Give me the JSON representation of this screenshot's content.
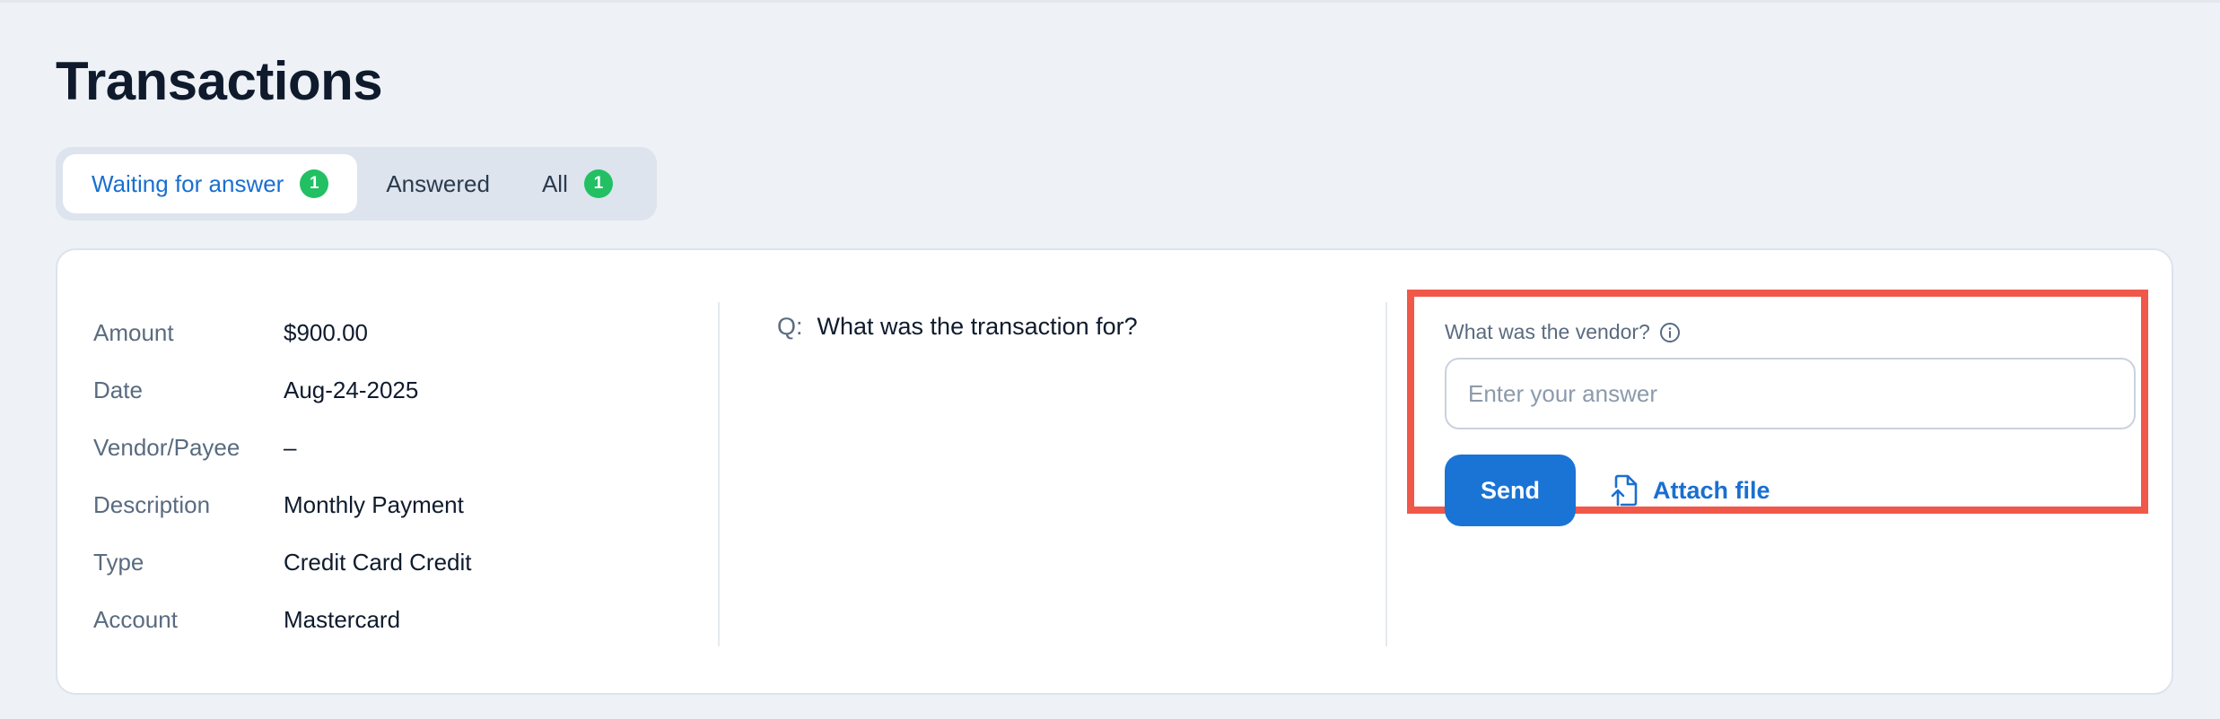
{
  "page": {
    "title": "Transactions"
  },
  "tabs": [
    {
      "label": "Waiting for answer",
      "badge": "1",
      "active": true
    },
    {
      "label": "Answered",
      "badge": null,
      "active": false
    },
    {
      "label": "All",
      "badge": "1",
      "active": false
    }
  ],
  "transaction": {
    "details": [
      {
        "label": "Amount",
        "value": "$900.00"
      },
      {
        "label": "Date",
        "value": "Aug-24-2025"
      },
      {
        "label": "Vendor/Payee",
        "value": "–"
      },
      {
        "label": "Description",
        "value": "Monthly Payment"
      },
      {
        "label": "Type",
        "value": "Credit Card Credit"
      },
      {
        "label": "Account",
        "value": "Mastercard"
      }
    ],
    "question": {
      "prefix": "Q:",
      "text": "What was the transaction for?"
    },
    "answer": {
      "label": "What was the vendor?",
      "placeholder": "Enter your answer",
      "value": "",
      "send_label": "Send",
      "attach_label": "Attach file"
    }
  },
  "colors": {
    "accent": "#1a74d6",
    "badge": "#22c063",
    "highlight_border": "#f0584a",
    "background": "#eef2f7"
  },
  "icons": {
    "info": "info-circle-icon",
    "attach": "file-upload-icon"
  }
}
